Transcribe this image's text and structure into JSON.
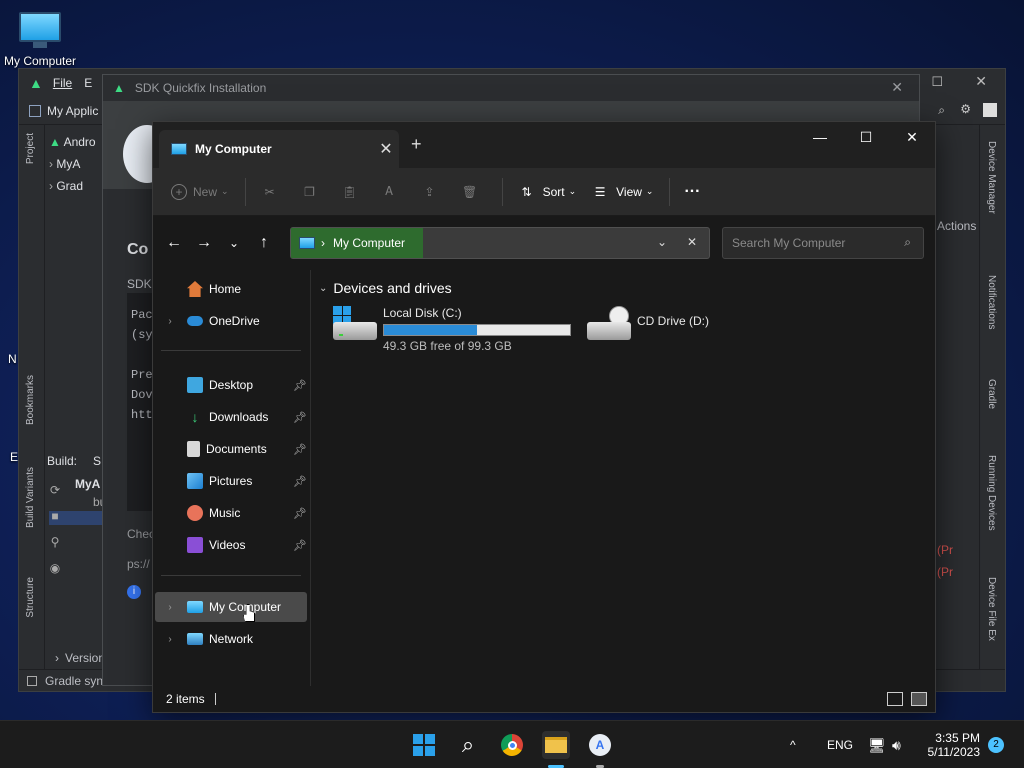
{
  "desktop": {
    "icon_label": "My Computer",
    "partial_labels": [
      "N",
      "E"
    ]
  },
  "android_studio": {
    "menu": [
      "File",
      "E"
    ],
    "project_title": "My Applic",
    "tree": [
      "Andro",
      "MyA",
      "Grad"
    ],
    "left_tabs": [
      "Project",
      "Bookmarks",
      "Build Variants",
      "Structure"
    ],
    "right_tabs": [
      "Device Manager",
      "Notifications",
      "Gradle",
      "Running Devices",
      "Device File Ex"
    ],
    "actions_label": "Actions",
    "build_label": "Build:",
    "build_tab": "S",
    "build_row": "MyA",
    "build_row2": "bu",
    "error_text": [
      "(Pr",
      "(Pr"
    ],
    "version_label": "Version",
    "status_text": "Gradle sync"
  },
  "sdk_dialog": {
    "title": "SDK Quickfix Installation",
    "heading": "Co",
    "sdk_label": "SDK",
    "package_lines": [
      "Pac",
      "(sy"
    ],
    "prep_lines": [
      "Pre",
      "Dov",
      "htt"
    ],
    "check_label": "Chec",
    "url_part": "ps://"
  },
  "explorer": {
    "tab_title": "My Computer",
    "new_tab": "+",
    "toolbar": {
      "new_label": "New",
      "sort_label": "Sort",
      "view_label": "View",
      "more": "···"
    },
    "address": {
      "crumb": "My Computer"
    },
    "search": {
      "placeholder": "Search My Computer"
    },
    "nav": {
      "top": [
        {
          "label": "Home",
          "icon": "home-icon"
        },
        {
          "label": "OneDrive",
          "icon": "onedrive-icon"
        }
      ],
      "pinned": [
        {
          "label": "Desktop",
          "icon": "desktop-folder-icon"
        },
        {
          "label": "Downloads",
          "icon": "downloads-icon"
        },
        {
          "label": "Documents",
          "icon": "documents-icon"
        },
        {
          "label": "Pictures",
          "icon": "pictures-icon"
        },
        {
          "label": "Music",
          "icon": "music-icon"
        },
        {
          "label": "Videos",
          "icon": "videos-icon"
        }
      ],
      "bottom": [
        {
          "label": "My Computer",
          "icon": "computer-icon",
          "selected": true
        },
        {
          "label": "Network",
          "icon": "network-icon"
        }
      ]
    },
    "group_title": "Devices and drives",
    "drives": [
      {
        "name": "Local Disk (C:)",
        "free_text": "49.3 GB free of 99.3 GB",
        "used_fraction": 0.5
      },
      {
        "name": "CD Drive (D:)"
      }
    ],
    "status": "2 items"
  },
  "taskbar": {
    "apps": [
      "start-icon",
      "search-icon",
      "chrome-icon",
      "file-explorer-icon",
      "android-studio-icon"
    ],
    "lang": "ENG",
    "time": "3:35 PM",
    "date": "5/11/2023",
    "notification_count": "2"
  },
  "colors": {
    "accent": "#2a8bd6",
    "address_highlight": "#2e6b2e",
    "explorer_bg": "#191919"
  }
}
